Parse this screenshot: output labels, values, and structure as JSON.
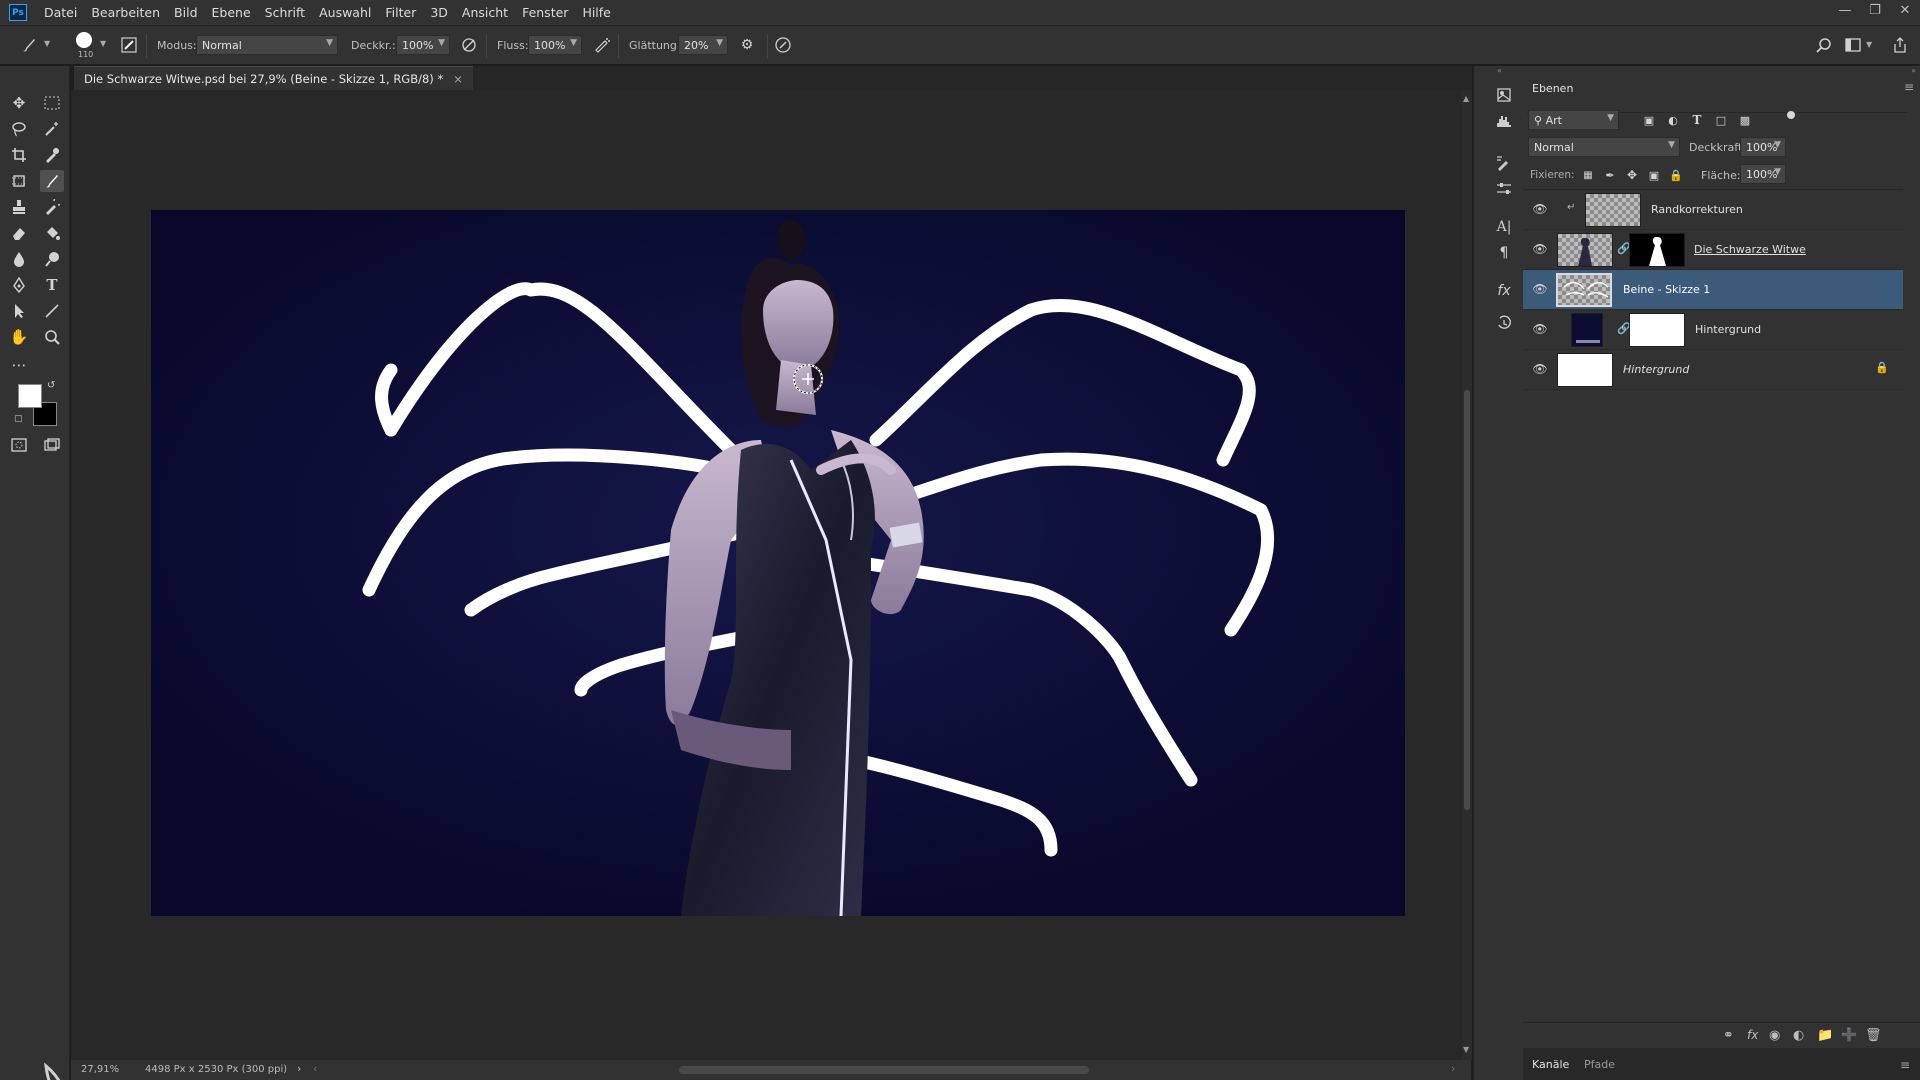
{
  "app": {
    "logo": "Ps",
    "menu": [
      "Datei",
      "Bearbeiten",
      "Bild",
      "Ebene",
      "Schrift",
      "Auswahl",
      "Filter",
      "3D",
      "Ansicht",
      "Fenster",
      "Hilfe"
    ]
  },
  "options": {
    "brush_size": "110",
    "modus_label": "Modus:",
    "modus_value": "Normal",
    "deckkraft_label": "Deckkr.:",
    "deckkraft_value": "100%",
    "fluss_label": "Fluss:",
    "fluss_value": "100%",
    "glaettung_label": "Glättung:",
    "glaettung_value": "20%"
  },
  "document": {
    "tab_title": "Die Schwarze Witwe.psd bei 27,9% (Beine - Skizze 1, RGB/8) *",
    "close": "×"
  },
  "statusbar": {
    "zoom": "27,91%",
    "size": "4498 Px x 2530 Px (300 ppi)"
  },
  "layers_panel": {
    "title": "Ebenen",
    "filter_value": "Art",
    "blend_mode": "Normal",
    "opacity_label": "Deckkraft:",
    "opacity_value": "100%",
    "lock_label": "Fixieren:",
    "fill_label": "Fläche:",
    "fill_value": "100%",
    "layers": [
      {
        "name": "Randkorrekturen",
        "selected": false,
        "italic": false
      },
      {
        "name": "Die Schwarze Witwe",
        "selected": false,
        "italic": false
      },
      {
        "name": "Beine - Skizze 1",
        "selected": true,
        "italic": false
      },
      {
        "name": "Hintergrund",
        "selected": false,
        "italic": false
      },
      {
        "name": "Hintergrund",
        "selected": false,
        "italic": true
      }
    ],
    "bottom_tabs": [
      "Kanäle",
      "Pfade"
    ]
  },
  "colors": {
    "canvas_bg": "#0a0b2e",
    "selected_layer": "#3c5a7a",
    "accent": "#2fa3f7"
  }
}
